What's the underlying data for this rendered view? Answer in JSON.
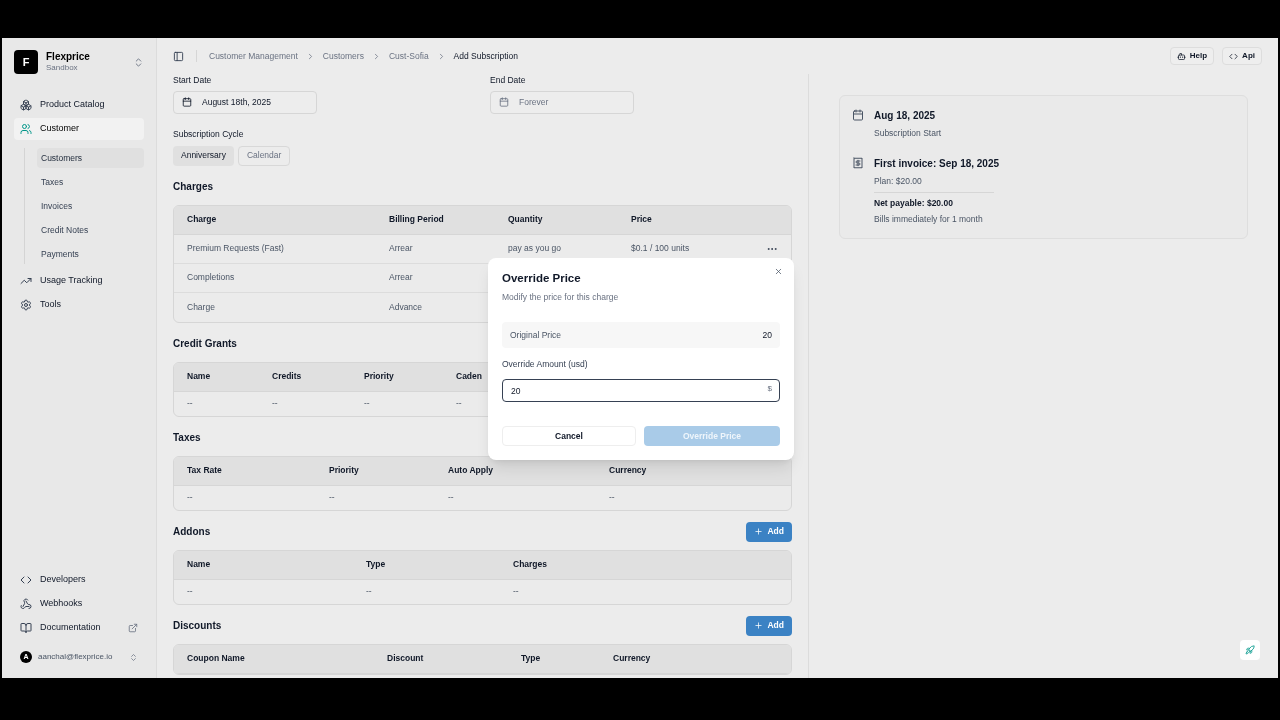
{
  "sidebar": {
    "brand": {
      "initial": "F",
      "name": "Flexprice",
      "env": "Sandbox"
    },
    "nav": [
      {
        "label": "Product Catalog",
        "selected": false
      },
      {
        "label": "Customer",
        "selected": true,
        "children": [
          {
            "label": "Customers",
            "selected": true
          },
          {
            "label": "Taxes",
            "selected": false
          },
          {
            "label": "Invoices",
            "selected": false
          },
          {
            "label": "Credit Notes",
            "selected": false
          },
          {
            "label": "Payments",
            "selected": false
          }
        ]
      },
      {
        "label": "Usage Tracking",
        "selected": false
      },
      {
        "label": "Tools",
        "selected": false
      }
    ],
    "footer": [
      {
        "label": "Developers",
        "external": false
      },
      {
        "label": "Webhooks",
        "external": false
      },
      {
        "label": "Documentation",
        "external": true
      }
    ],
    "user": {
      "initial": "A",
      "email": "aanchal@flexprice.io"
    }
  },
  "breadcrumb": [
    {
      "label": "Customer Management",
      "current": false
    },
    {
      "label": "Customers",
      "current": false
    },
    {
      "label": "Cust-Sofia",
      "current": false
    },
    {
      "label": "Add Subscription",
      "current": true
    }
  ],
  "header_buttons": [
    {
      "label": "Help"
    },
    {
      "label": "Api"
    }
  ],
  "form": {
    "start_date": {
      "label": "Start Date",
      "value": "August 18th, 2025"
    },
    "end_date": {
      "label": "End Date",
      "placeholder": "Forever"
    },
    "cycle": {
      "label": "Subscription Cycle",
      "options": [
        {
          "label": "Anniversary",
          "selected": true
        },
        {
          "label": "Calendar",
          "selected": false
        }
      ]
    }
  },
  "sections": [
    {
      "title": "Charges",
      "columns": [
        "Charge",
        "Billing Period",
        "Quantity",
        "Price"
      ],
      "rows": [
        {
          "cells": [
            "Premium Requests (Fast)",
            "Arrear",
            "pay as you go",
            "$0.1 / 100 units"
          ],
          "menu": true
        },
        {
          "cells": [
            "Completions",
            "Arrear"
          ]
        },
        {
          "cells": [
            "Charge",
            "Advance"
          ]
        }
      ]
    },
    {
      "title": "Credit Grants",
      "columns": [
        "Name",
        "Credits",
        "Priority",
        "Caden"
      ],
      "rows": [
        {
          "cells": [
            "--",
            "--",
            "--",
            "--"
          ]
        }
      ]
    },
    {
      "title": "Taxes",
      "columns": [
        "Tax Rate",
        "Priority",
        "Auto Apply",
        "Currency"
      ],
      "rows": [
        {
          "cells": [
            "--",
            "--",
            "--",
            "--"
          ]
        }
      ]
    },
    {
      "title": "Addons",
      "add_button": "Add",
      "columns": [
        "Name",
        "Type",
        "Charges"
      ],
      "rows": [
        {
          "cells": [
            "--",
            "--",
            "--"
          ]
        }
      ]
    },
    {
      "title": "Discounts",
      "add_button": "Add",
      "columns": [
        "Coupon Name",
        "Discount",
        "Type",
        "Currency"
      ]
    }
  ],
  "timeline": [
    {
      "title": "Aug 18, 2025",
      "lines": [
        {
          "text": "Subscription Start",
          "kind": "plain"
        }
      ]
    },
    {
      "title": "First invoice: Sep 18, 2025",
      "lines": [
        {
          "text": "Plan: $20.00",
          "kind": "plain"
        },
        {
          "text": "Net payable: $20.00",
          "kind": "total"
        },
        {
          "text": "Bills immediately for 1 month",
          "kind": "plain"
        }
      ]
    }
  ],
  "dialog": {
    "title": "Override Price",
    "subtitle": "Modify the price for this charge",
    "original_label": "Original Price",
    "original_value": "20",
    "amount_label": "Override Amount (usd)",
    "amount_value": "20",
    "currency_symbol": "$",
    "cancel": "Cancel",
    "submit": {
      "label": "Override Price",
      "disabled": true
    }
  }
}
